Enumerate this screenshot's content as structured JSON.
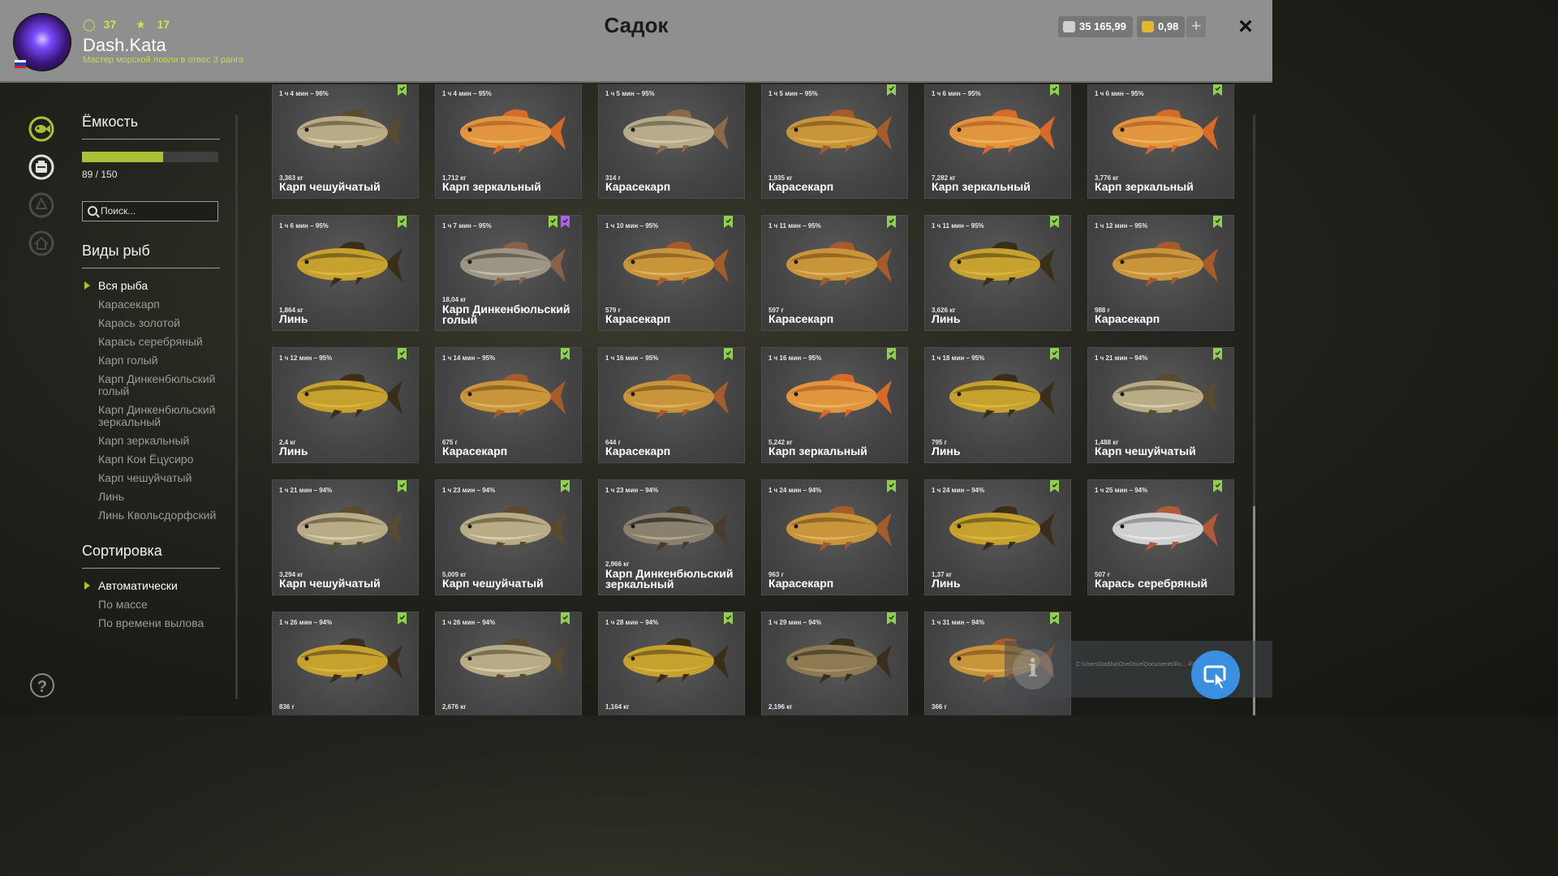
{
  "header": {
    "title": "Садок",
    "username": "Dash.Kata",
    "level": "37",
    "stars": "17",
    "rank": "Мастер морской ловли в отвес 3 ранга",
    "silver": "35 165,99",
    "gold": "0,98",
    "plus": "+",
    "close": "×"
  },
  "sidebar": {
    "capacity_title": "Ёмкость",
    "capacity_value": "89 / 150",
    "capacity_fraction": 0.593,
    "search_placeholder": "Поиск...",
    "species_title": "Виды рыб",
    "species": [
      "Вся рыба",
      "Карасекарп",
      "Карась золотой",
      "Карась серебряный",
      "Карп голый",
      "Карп Динкенбюльский голый",
      "Карп Динкенбюльский зеркальный",
      "Карп зеркальный",
      "Карп Кои Ёцусиро",
      "Карп чешуйчатый",
      "Линь",
      "Линь Квольсдорфский"
    ],
    "sort_title": "Сортировка",
    "sort_options": [
      "Автоматически",
      "По массе",
      "По времени вылова"
    ],
    "help": "?"
  },
  "overlay": {
    "info": "i",
    "path": "C:\\Users\\DaSha\\OneDrive\\Documents\\Ru... 4\\Screenshots\\rf4_4.0.24502_20260512_1..."
  },
  "colors": {
    "accent_green": "#a7c236",
    "bookmark_green": "#8fd14f",
    "bookmark_purple": "#b45cf0",
    "header_bg": "#8f8f8f"
  },
  "fish": [
    {
      "time": "1 ч 4 мин – 96%",
      "weight": "3,363 кг",
      "name": "Карп чешуйчатый",
      "tone": "scaly",
      "marks": [
        "green"
      ]
    },
    {
      "time": "1 ч 4 мин – 95%",
      "weight": "1,712 кг",
      "name": "Карп зеркальный",
      "tone": "mirror",
      "marks": []
    },
    {
      "time": "1 ч 5 мин – 95%",
      "weight": "314 г",
      "name": "Карасекарп",
      "tone": "silverish",
      "marks": []
    },
    {
      "time": "1 ч 5 мин – 95%",
      "weight": "1,935 кг",
      "name": "Карасекарп",
      "tone": "gold",
      "marks": [
        "green"
      ]
    },
    {
      "time": "1 ч 6 мин – 95%",
      "weight": "7,282 кг",
      "name": "Карп зеркальный",
      "tone": "mirror",
      "marks": [
        "green"
      ]
    },
    {
      "time": "1 ч 6 мин – 95%",
      "weight": "3,776 кг",
      "name": "Карп зеркальный",
      "tone": "mirror",
      "marks": [
        "green"
      ]
    },
    {
      "time": "1 ч 6 мин – 95%",
      "weight": "1,864 кг",
      "name": "Линь",
      "tone": "tench",
      "marks": [
        "green"
      ]
    },
    {
      "time": "1 ч 7 мин – 95%",
      "weight": "18,04 кг",
      "name": "Карп Динкенбюльский голый",
      "tone": "leather",
      "marks": [
        "green",
        "purple"
      ]
    },
    {
      "time": "1 ч 10 мин – 95%",
      "weight": "579 г",
      "name": "Карасекарп",
      "tone": "gold",
      "marks": [
        "green"
      ]
    },
    {
      "time": "1 ч 11 мин – 95%",
      "weight": "597 г",
      "name": "Карасекарп",
      "tone": "gold",
      "marks": [
        "green"
      ]
    },
    {
      "time": "1 ч 11 мин – 95%",
      "weight": "3,626 кг",
      "name": "Линь",
      "tone": "tench",
      "marks": [
        "green"
      ]
    },
    {
      "time": "1 ч 12 мин – 95%",
      "weight": "988 г",
      "name": "Карасекарп",
      "tone": "gold",
      "marks": [
        "green"
      ]
    },
    {
      "time": "1 ч 12 мин – 95%",
      "weight": "2,4 кг",
      "name": "Линь",
      "tone": "tench",
      "marks": [
        "green"
      ]
    },
    {
      "time": "1 ч 14 мин – 95%",
      "weight": "675 г",
      "name": "Карасекарп",
      "tone": "gold",
      "marks": [
        "green"
      ]
    },
    {
      "time": "1 ч 16 мин – 95%",
      "weight": "644 г",
      "name": "Карасекарп",
      "tone": "gold",
      "marks": [
        "green"
      ]
    },
    {
      "time": "1 ч 16 мин – 95%",
      "weight": "5,242 кг",
      "name": "Карп зеркальный",
      "tone": "mirror",
      "marks": [
        "green"
      ]
    },
    {
      "time": "1 ч 18 мин – 95%",
      "weight": "795 г",
      "name": "Линь",
      "tone": "tench",
      "marks": [
        "green"
      ]
    },
    {
      "time": "1 ч 21 мин – 94%",
      "weight": "1,488 кг",
      "name": "Карп чешуйчатый",
      "tone": "scaly",
      "marks": [
        "green"
      ]
    },
    {
      "time": "1 ч 21 мин – 94%",
      "weight": "3,294 кг",
      "name": "Карп чешуйчатый",
      "tone": "scaly",
      "marks": [
        "green"
      ]
    },
    {
      "time": "1 ч 23 мин – 94%",
      "weight": "5,009 кг",
      "name": "Карп чешуйчатый",
      "tone": "scaly",
      "marks": [
        "green"
      ]
    },
    {
      "time": "1 ч 23 мин – 94%",
      "weight": "2,966 кг",
      "name": "Карп Динкенбюльский зеркальный",
      "tone": "dark",
      "marks": []
    },
    {
      "time": "1 ч 24 мин – 94%",
      "weight": "963 г",
      "name": "Карасекарп",
      "tone": "gold",
      "marks": [
        "green"
      ]
    },
    {
      "time": "1 ч 24 мин – 94%",
      "weight": "1,37 кг",
      "name": "Линь",
      "tone": "tench",
      "marks": [
        "green"
      ]
    },
    {
      "time": "1 ч 25 мин – 94%",
      "weight": "507 г",
      "name": "Карась серебряный",
      "tone": "silver",
      "marks": [
        "green"
      ]
    },
    {
      "time": "1 ч 26 мин – 94%",
      "weight": "836 г",
      "name": "",
      "tone": "tench",
      "marks": [
        "green"
      ]
    },
    {
      "time": "1 ч 26 мин – 94%",
      "weight": "2,676 кг",
      "name": "",
      "tone": "scaly",
      "marks": [
        "green"
      ]
    },
    {
      "time": "1 ч 28 мин – 94%",
      "weight": "1,164 кг",
      "name": "",
      "tone": "tench",
      "marks": [
        "green"
      ]
    },
    {
      "time": "1 ч 29 мин – 94%",
      "weight": "2,196 кг",
      "name": "",
      "tone": "darktench",
      "marks": [
        "green"
      ]
    },
    {
      "time": "1 ч 31 мин – 94%",
      "weight": "366 г",
      "name": "",
      "tone": "gold",
      "marks": [
        "green"
      ]
    }
  ]
}
